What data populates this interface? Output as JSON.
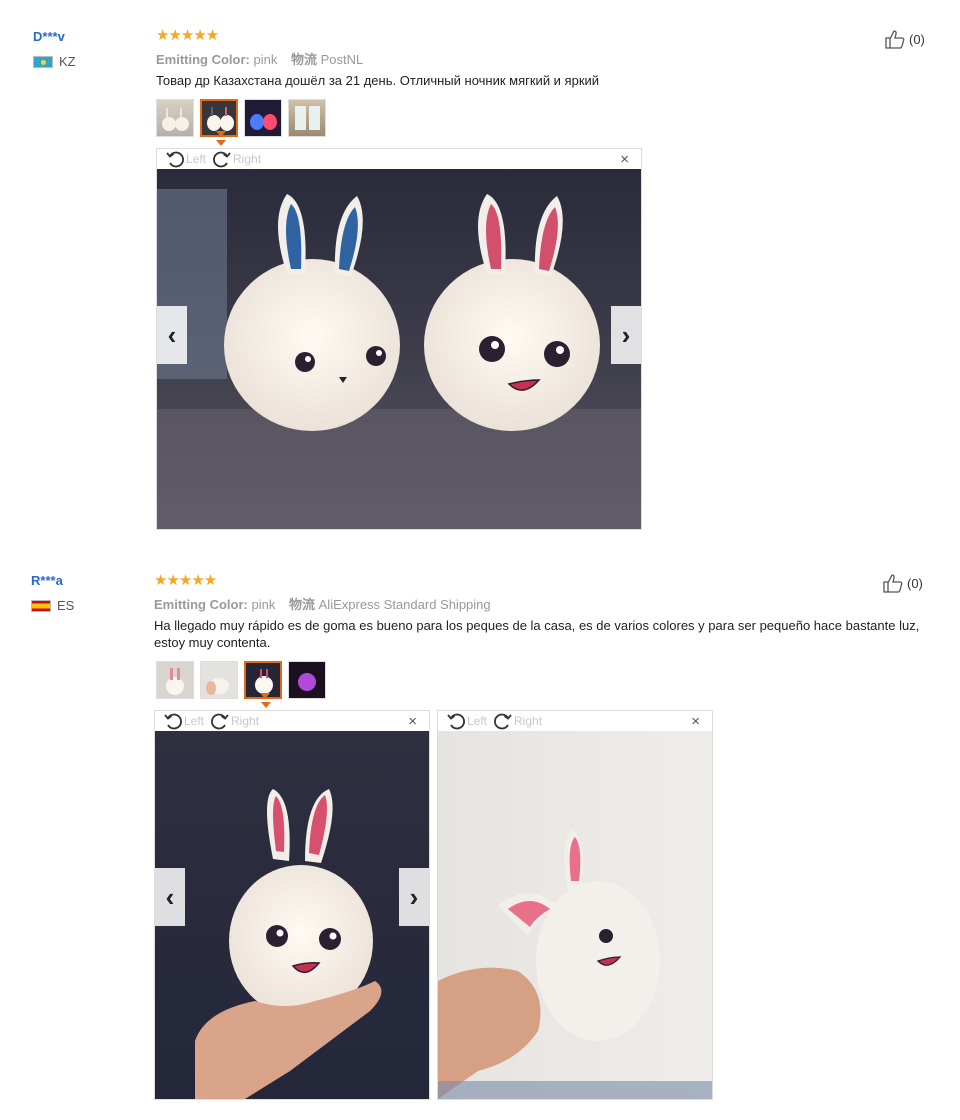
{
  "reviews": [
    {
      "user": "D***v",
      "country": "KZ",
      "stars": "★★★★★",
      "color_label": "Emitting Color:",
      "color_value": "pink",
      "shipping_label": "物流",
      "shipping_value": "PostNL",
      "text": "Товар др Казахстана дошёл за 21 день. Отличный ночник мягкий и яркий",
      "likes": "(0)",
      "thumbnails": [
        "thumb-1",
        "thumb-2",
        "thumb-3",
        "thumb-4"
      ],
      "viewer": {
        "left": "Left",
        "right": "Right",
        "close": "×"
      }
    },
    {
      "user": "R***a",
      "country": "ES",
      "stars": "★★★★★",
      "color_label": "Emitting Color:",
      "color_value": "pink",
      "shipping_label": "物流",
      "shipping_value": "AliExpress Standard Shipping",
      "text": "Ha llegado muy rápido es de goma es bueno para los peques de la casa, es de varios colores y para ser pequeño hace bastante luz, estoy muy contenta.",
      "likes": "(0)",
      "thumbnails": [
        "thumb-1",
        "thumb-2",
        "thumb-3",
        "thumb-4"
      ],
      "viewer": {
        "left": "Left",
        "right": "Right",
        "close": "×"
      },
      "viewer2": {
        "left": "Left",
        "right": "Right",
        "close": "×"
      }
    }
  ],
  "icons": {
    "thumbs_up": "thumbs-up-icon",
    "rotate_left": "rotate-left-icon",
    "rotate_right": "rotate-right-icon",
    "prev": "chevron-left-icon",
    "next": "chevron-right-icon"
  },
  "colors": {
    "username": "#2a6acb",
    "stars": "#f5a623",
    "selected_thumb": "#e46a1b"
  }
}
